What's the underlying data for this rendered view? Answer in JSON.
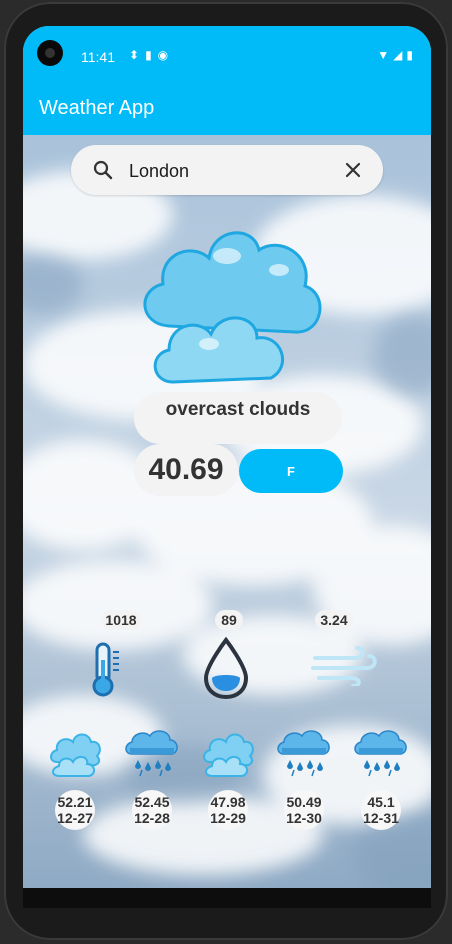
{
  "status_bar": {
    "time": "11:41",
    "left_icons": [
      "navigation-icon",
      "sd-card-icon",
      "app-notification-icon"
    ],
    "right_icons": [
      "wifi-icon",
      "signal-icon",
      "battery-icon"
    ]
  },
  "app_bar": {
    "title": "Weather App"
  },
  "search": {
    "value": "London",
    "placeholder": ""
  },
  "current": {
    "description": "overcast clouds",
    "temperature": "40.69",
    "unit_button": "F",
    "icon": "cloud-icon"
  },
  "stats": [
    {
      "value": "1018",
      "icon": "thermometer-icon"
    },
    {
      "value": "89",
      "icon": "humidity-drop-icon"
    },
    {
      "value": "3.24",
      "icon": "wind-icon"
    }
  ],
  "forecast": [
    {
      "temp": "52.21",
      "date": "12-27",
      "icon": "cloud-icon"
    },
    {
      "temp": "52.45",
      "date": "12-28",
      "icon": "rain-cloud-icon"
    },
    {
      "temp": "47.98",
      "date": "12-29",
      "icon": "cloud-icon"
    },
    {
      "temp": "50.49",
      "date": "12-30",
      "icon": "rain-cloud-icon"
    },
    {
      "temp": "45.1",
      "date": "12-31",
      "icon": "rain-cloud-icon"
    }
  ],
  "colors": {
    "accent": "#00bbf7",
    "pill": "#f3f3f4",
    "text": "#333333"
  }
}
